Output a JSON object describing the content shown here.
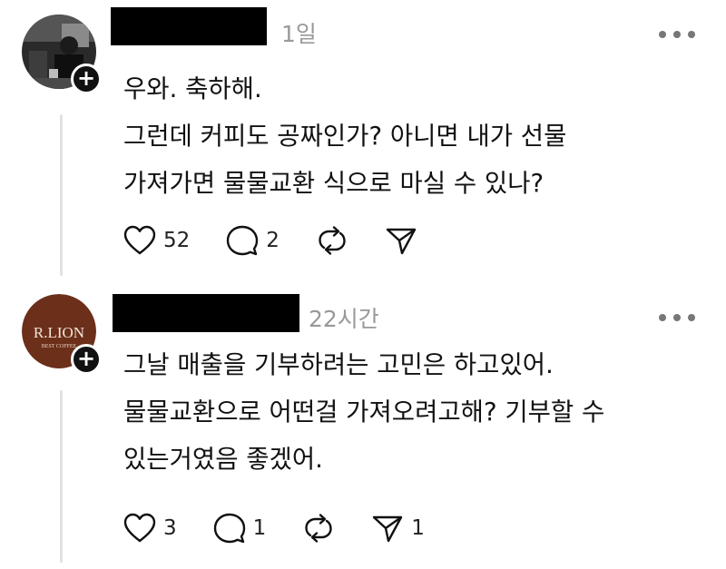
{
  "posts": [
    {
      "timestamp": "1일",
      "lines": [
        "우와. 축하해.",
        "그런데 커피도 공짜인가? 아니면 내가 선물",
        "가져가면 물물교환 식으로 마실 수 있나?"
      ],
      "likes": "52",
      "replies": "2",
      "reposts": "",
      "shares": ""
    },
    {
      "avatar_text": "R.LION",
      "avatar_subtext": "BEST COFFEE",
      "timestamp": "22시간",
      "lines": [
        "그날 매출을 기부하려는 고민은 하고있어.",
        "물물교환으로 어떤걸 가져오려고해? 기부할 수",
        "있는거였음 좋겠어."
      ],
      "likes": "3",
      "replies": "1",
      "reposts": "",
      "shares": "1"
    }
  ],
  "icons": {
    "like": "heart-icon",
    "reply": "speech-bubble-icon",
    "repost": "repost-arrows-icon",
    "share": "paper-plane-icon",
    "more": "more-horizontal-icon",
    "follow": "plus-icon"
  },
  "colors": {
    "text": "#111111",
    "muted": "#999999",
    "thread_line": "#e2e2e2",
    "rlion_avatar_bg": "#6b2f1a"
  }
}
